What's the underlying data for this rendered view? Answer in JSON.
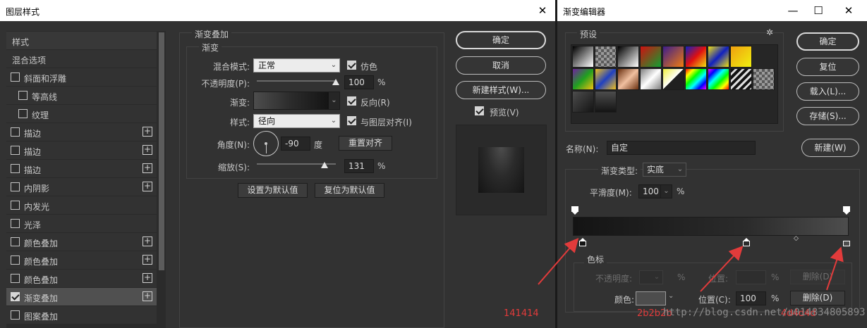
{
  "layer_style": {
    "title": "图层样式",
    "sidebar": {
      "header": "样式",
      "blend_options": "混合选项",
      "items": [
        {
          "label": "斜面和浮雕",
          "checked": false,
          "plus": false
        },
        {
          "label": "等高线",
          "checked": false,
          "plus": false
        },
        {
          "label": "纹理",
          "checked": false,
          "plus": false
        },
        {
          "label": "描边",
          "checked": false,
          "plus": true
        },
        {
          "label": "描边",
          "checked": false,
          "plus": true
        },
        {
          "label": "描边",
          "checked": false,
          "plus": true
        },
        {
          "label": "内阴影",
          "checked": false,
          "plus": true
        },
        {
          "label": "内发光",
          "checked": false,
          "plus": false
        },
        {
          "label": "光泽",
          "checked": false,
          "plus": false
        },
        {
          "label": "颜色叠加",
          "checked": false,
          "plus": true
        },
        {
          "label": "颜色叠加",
          "checked": false,
          "plus": true
        },
        {
          "label": "颜色叠加",
          "checked": false,
          "plus": true
        },
        {
          "label": "渐变叠加",
          "checked": true,
          "plus": true
        },
        {
          "label": "图案叠加",
          "checked": false,
          "plus": false
        }
      ]
    },
    "panel": {
      "section_title": "渐变叠加",
      "group_title": "渐变",
      "blend_mode_label": "混合模式:",
      "blend_mode_value": "正常",
      "dither_label": "仿色",
      "opacity_label": "不透明度(P):",
      "opacity_value": "100",
      "opacity_fraction": 1.0,
      "percent": "%",
      "gradient_label": "渐变:",
      "reverse_label": "反向(R)",
      "style_label": "样式:",
      "style_value": "径向",
      "align_label": "与图层对齐(I)",
      "angle_label": "角度(N):",
      "angle_value": "-90",
      "angle_unit": "度",
      "reset_align": "重置对齐",
      "scale_label": "缩放(S):",
      "scale_value": "131",
      "scale_fraction": 0.86,
      "set_default": "设置为默认值",
      "reset_default": "复位为默认值"
    },
    "buttons": {
      "ok": "确定",
      "cancel": "取消",
      "new_style": "新建样式(W)...",
      "preview": "预览(V)"
    }
  },
  "gradient_editor": {
    "title": "渐变编辑器",
    "presets_label": "预设",
    "buttons": {
      "ok": "确定",
      "reset": "复位",
      "load": "载入(L)...",
      "save": "存储(S)...",
      "new": "新建(W)"
    },
    "name_label": "名称(N):",
    "name_value": "自定",
    "type_label": "渐变类型:",
    "type_value": "实底",
    "smooth_label": "平滑度(M):",
    "smooth_value": "100",
    "percent": "%",
    "stops_group": "色标",
    "stop_opacity_label": "不透明度:",
    "stop_location_label": "位置:",
    "delete_label": "删除(D)",
    "color_label": "颜色:",
    "location_label": "位置(C):",
    "location_value": "100",
    "delete_label_2": "删除(D)"
  },
  "annotations": {
    "left_hex": "141414",
    "mid_hex": "2b2b2b",
    "right_hex": "4d4d4d",
    "watermark": "http://blog.csdn.net/u014834805893"
  },
  "colors": {
    "stop_left": "#141414",
    "stop_mid": "#2b2b2b",
    "stop_right": "#4d4d4d",
    "annotation": "#e23b3b"
  }
}
